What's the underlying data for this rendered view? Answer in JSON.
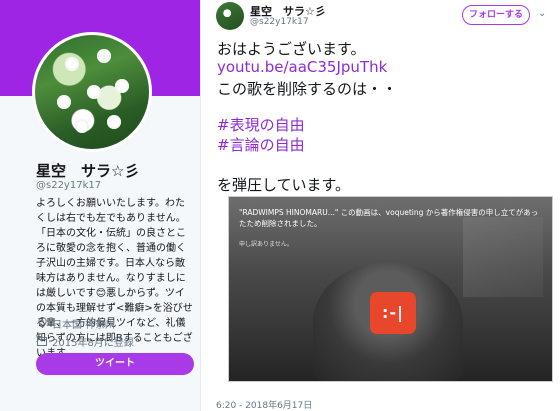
{
  "profile": {
    "name": "星空　サラ☆彡",
    "handle": "@s22y17k17",
    "bio": "よろしくお願いいたします。わたくしは右でも左でもありません。「日本の文化・伝統」の良さところに敬愛の念を抱く、普通の働く子沢山の主婦です。日本人なら敵味方はありません。なりすましには厳しいです😊悪しからず。ツイの本質も理解せず<難癖>を浴びせる輩、一方的偏見ツイなど、礼儀知らずの方には即Bすることもございます。",
    "location": "日本国 神奈川",
    "joined": "2015年8月に登録",
    "tweet_button": "ツイート",
    "icons": {
      "location": "location-pin-icon",
      "joined": "calendar-icon"
    },
    "colors": {
      "banner": "#9f25e4",
      "accent": "#a83ae8"
    }
  },
  "tweet": {
    "author_name": "星空　サラ☆彡",
    "author_handle": "@s22y17k17",
    "follow_button": "フォローする",
    "line1": "おはようございます。",
    "link": "youtu.be/aaC35JpuThk",
    "line3": "この歌を削除するのは・・",
    "hashtag1": "#表現の自由",
    "hashtag2": "#言論の自由",
    "line6": "を弾圧しています。",
    "timestamp": "6:20 - 2018年6月17日"
  },
  "video": {
    "message": "\"RADWIMPS HINOMARU...\" この動画は、voqueting から著作権侵害の申し立てがあったため削除されました。",
    "sub": "申し訳ありません。",
    "error_face": ":-|"
  }
}
